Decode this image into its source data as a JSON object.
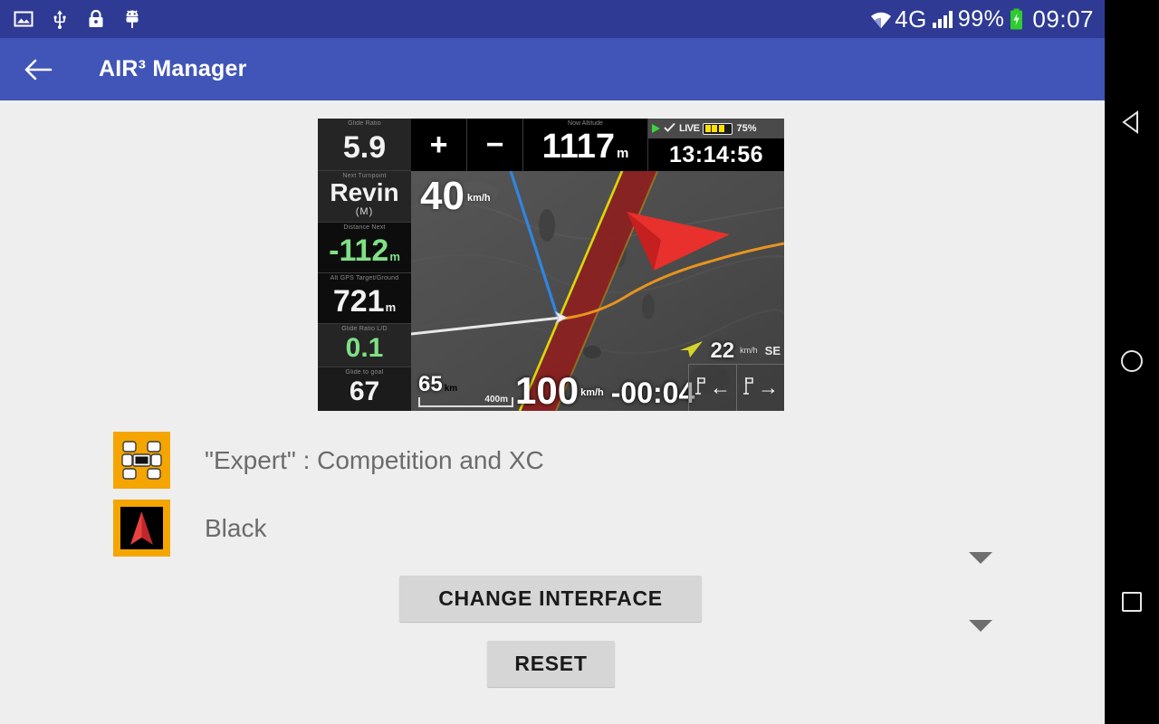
{
  "statusbar": {
    "icons": [
      "image-icon",
      "usb-icon",
      "lock-icon",
      "android-icon"
    ],
    "network": "4G",
    "battery_percent": "99%",
    "clock": "09:07"
  },
  "appbar": {
    "back_icon": "back-arrow-icon",
    "title": "AIR³ Manager"
  },
  "device_preview": {
    "left_column": [
      {
        "label": "Glide Ratio",
        "value": "5.9",
        "unit": "",
        "color": "white"
      },
      {
        "label": "Next Turnpoint",
        "value": "Revin",
        "sub": "(M)",
        "unit": "",
        "color": "white"
      },
      {
        "label": "Distance Next",
        "value": "-112",
        "unit": "m",
        "color": "green"
      },
      {
        "label": "Alt GPS Target/Ground",
        "value": "721",
        "unit": "m",
        "color": "white"
      },
      {
        "label": "Glide Ratio L/D",
        "value": "0.1",
        "unit": "",
        "color": "green"
      },
      {
        "label": "Glide to goal",
        "value": "67",
        "unit": "",
        "color": "white"
      }
    ],
    "top_bar": {
      "zoom_in": "+",
      "zoom_out": "−",
      "altitude_label": "Now Altitude",
      "altitude_value": "1117",
      "altitude_unit": "m",
      "live_text": "LIVE",
      "device_battery": "75%",
      "clock": "13:14:56"
    },
    "map": {
      "speed": "40",
      "speed_unit": "km/h",
      "wind_speed": "22",
      "wind_unit": "km/h",
      "wind_dir": "SE",
      "scale_distance": "65",
      "scale_distance_unit": "km",
      "scale_bar": "400m",
      "ground_speed": "100",
      "ground_speed_unit": "km/h",
      "eta": "-00:04",
      "prev_waypoint_arrow": "←",
      "next_waypoint_arrow": "→"
    }
  },
  "options": [
    {
      "icon": "layout-grid-icon",
      "label": "\"Expert\" : Competition and XC",
      "caret": "chevron-down-icon"
    },
    {
      "icon": "red-arrow-icon",
      "label": "Black",
      "caret": "chevron-down-icon"
    }
  ],
  "buttons": {
    "change_interface": "CHANGE INTERFACE",
    "reset": "RESET"
  },
  "navbar": {
    "back": "back-triangle-icon",
    "home": "home-circle-icon",
    "recents": "recents-square-icon"
  },
  "colors": {
    "statusbar_bg": "#2e3a93",
    "appbar_bg": "#4055b7",
    "page_bg": "#eeeeee",
    "accent_orange": "#f5a500",
    "button_bg": "#d6d6d6",
    "battery_green": "#3cd43c",
    "device_green": "#7fe085"
  }
}
